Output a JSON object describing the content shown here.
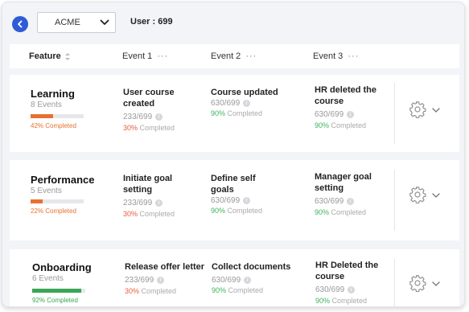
{
  "toolbar": {
    "select_value": "ACME",
    "user_label": "User : 699"
  },
  "table_header": {
    "feature": "Feature",
    "event1": "Event 1",
    "event2": "Event 2",
    "event3": "Event 3",
    "more": "···"
  },
  "colors": {
    "accent": "#2f5bd6",
    "orange": "#e8702f",
    "green": "#3aa655",
    "red": "#e55b3a"
  },
  "rows": [
    {
      "name": "Learning",
      "events": "8 Events",
      "progress": 0.42,
      "completed": "42% Completed",
      "e1": {
        "title": "User course created",
        "count": "233/699",
        "pct": "30%",
        "status": " Completed"
      },
      "e2": {
        "title": "Course updated",
        "count": "630/699",
        "pct": "90%",
        "status": " Completed"
      },
      "e3": {
        "title": "HR deleted the course",
        "count": "630/699",
        "pct": "90%",
        "status": " Completed"
      }
    },
    {
      "name": "Performance",
      "events": "5 Events",
      "progress": 0.22,
      "completed": "22% Completed",
      "e1": {
        "title": "Initiate goal setting",
        "count": "233/699",
        "pct": "30%",
        "status": " Completed"
      },
      "e2": {
        "title": "Define self goals",
        "count": "630/699",
        "pct": "90%",
        "status": " Completed"
      },
      "e3": {
        "title": "Manager goal setting",
        "count": "630/699",
        "pct": "90%",
        "status": " Completed"
      }
    },
    {
      "name": "Onboarding",
      "events": "6 Events",
      "progress": 0.92,
      "completed": "92% Completed",
      "e1": {
        "title": "Release offer letter",
        "count": "233/699",
        "pct": "30%",
        "status": " Completed"
      },
      "e2": {
        "title": "Collect documents",
        "count": "630/699",
        "pct": "90%",
        "status": " Completed"
      },
      "e3": {
        "title": "HR Deleted the course",
        "count": "630/699",
        "pct": "90%",
        "status": " Completed"
      }
    }
  ]
}
